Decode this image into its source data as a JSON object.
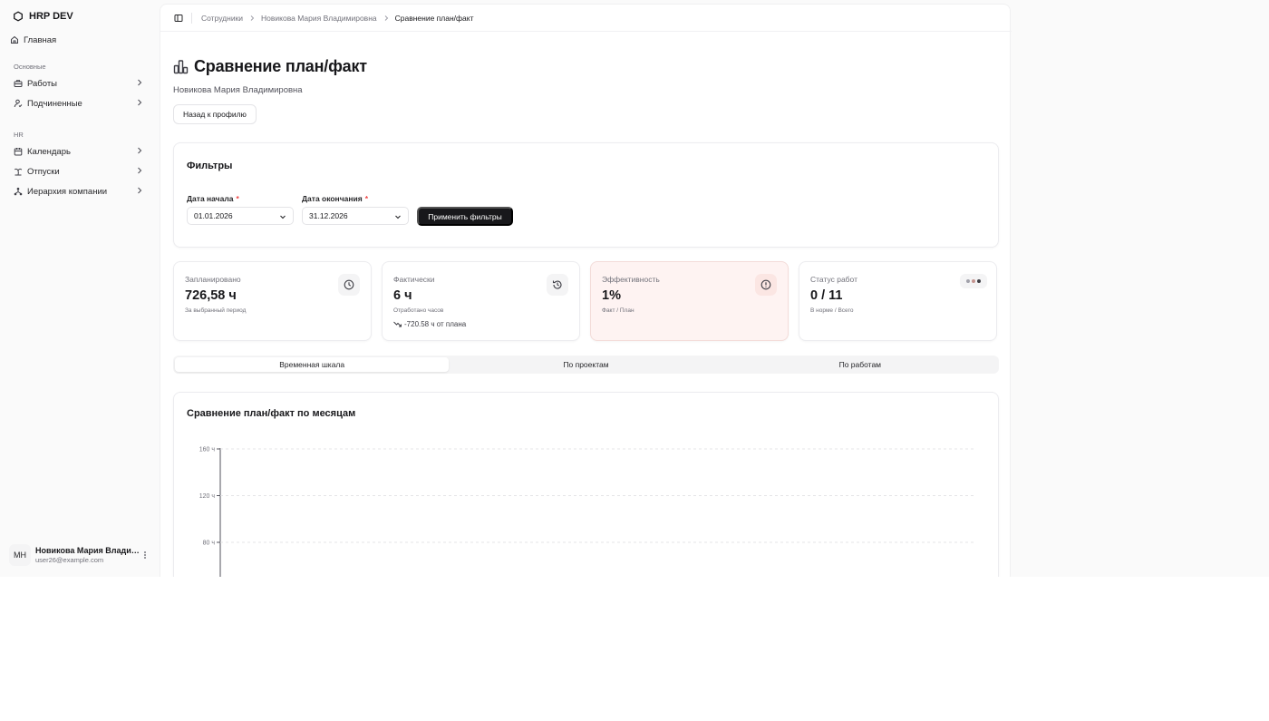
{
  "sidebar": {
    "brand": "HRP DEV",
    "home": "Главная",
    "section_main": "Основные",
    "main_items": [
      "Работы",
      "Подчиненные"
    ],
    "section_hr": "HR",
    "hr_items": [
      "Календарь",
      "Отпуски",
      "Иерархия компании"
    ],
    "user": {
      "initials": "МН",
      "name": "Новикова Мария Владимировна",
      "email": "user26@example.com"
    }
  },
  "breadcrumb": [
    "Сотрудники",
    "Новикова Мария Владимировна",
    "Сравнение план/факт"
  ],
  "page": {
    "title": "Сравнение план/факт",
    "subtitle": "Новикова Мария Владимировна",
    "back_button": "Назад к профилю"
  },
  "filters": {
    "title": "Фильтры",
    "start_label": "Дата начала",
    "start_value": "01.01.2026",
    "end_label": "Дата окончания",
    "end_value": "31.12.2026",
    "required_mark": "*",
    "apply_button": "Применить фильтры"
  },
  "stats": [
    {
      "label": "Запланировано",
      "value": "726,58 ч",
      "note": "За выбранный период",
      "icon": "clock-icon"
    },
    {
      "label": "Фактически",
      "value": "6 ч",
      "note": "Отработано часов",
      "trend": "-720.58 ч от плана",
      "icon": "clock-history-icon"
    },
    {
      "label": "Эффективность",
      "value": "1%",
      "note": "Факт / План",
      "icon": "alert-circle-icon"
    },
    {
      "label": "Статус работ",
      "value": "0 / 11",
      "note": "В норме / Всего",
      "icon": "status-dots-icon"
    }
  ],
  "colors": {
    "accent": "#18181b",
    "efficiency_bg": "#fef3f2",
    "status_dots": [
      "#a1a1aa",
      "#c4948f",
      "#3f3f46"
    ]
  },
  "tabs": [
    "Временная шкала",
    "По проектам",
    "По работам"
  ],
  "active_tab": 0,
  "chart_data": {
    "type": "bar",
    "title": "Сравнение план/факт по месяцам",
    "xlabel": "",
    "ylabel": "",
    "y_ticks": [
      160,
      120,
      80
    ],
    "y_unit": "ч",
    "visible_ylim": [
      70,
      160
    ],
    "grid": true,
    "series": []
  }
}
